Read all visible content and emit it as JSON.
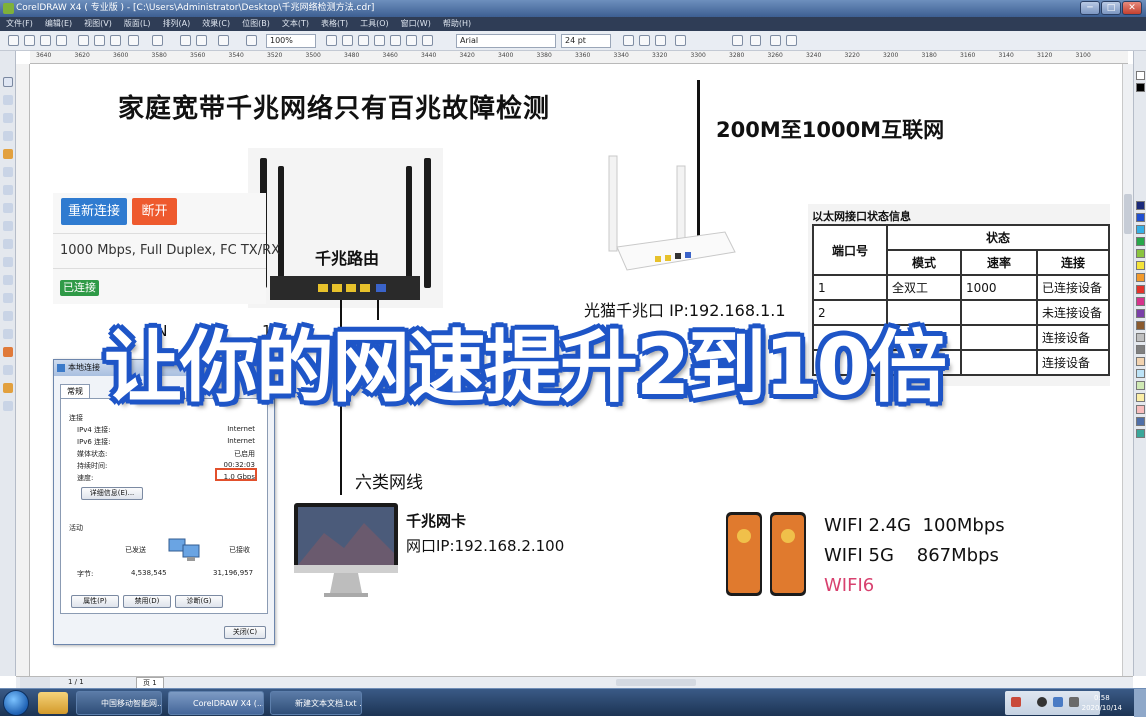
{
  "window": {
    "title": "CorelDRAW X4 ( 专业版 ) - [C:\\Users\\Administrator\\Desktop\\千兆网络检测方法.cdr]",
    "menu": [
      "文件(F)",
      "编辑(E)",
      "视图(V)",
      "版面(L)",
      "排列(A)",
      "效果(C)",
      "位图(B)",
      "文本(T)",
      "表格(T)",
      "工具(O)",
      "窗口(W)",
      "帮助(H)"
    ],
    "zoom": "100%",
    "font": "Arial",
    "font_size": "24 pt"
  },
  "ruler": [
    "3640",
    "3620",
    "3600",
    "3580",
    "3560",
    "3540",
    "3520",
    "3500",
    "3480",
    "3460",
    "3440",
    "3420",
    "3400",
    "3380",
    "3360",
    "3340",
    "3320",
    "3300",
    "3280",
    "3260",
    "3240",
    "3220",
    "3200",
    "3180",
    "3160",
    "3140",
    "3120",
    "3100"
  ],
  "statusbar": {
    "page_count": "1 / 1",
    "page_tab": "页 1"
  },
  "slide": {
    "title": "家庭宽带千兆网络只有百兆故障检测",
    "internet": "200M至1000M互联网",
    "route_panel": {
      "reconnect": "重新连接",
      "disconnect": "断开",
      "speed": "1000 Mbps, Full Duplex, FC TX/RX",
      "status": "已连接"
    },
    "router_label": "千兆路由",
    "modem_label": "光猫千兆口 IP:192.168.1.1",
    "wan_fragment": "AN",
    "lan_fragment": "16",
    "cable_label": "六类网线",
    "nic": {
      "title": "千兆网卡",
      "ip": "网口IP:192.168.2.100"
    },
    "wifi": {
      "line1": "WIFI 2.4G  100Mbps",
      "line2": "WIFI 5G    867Mbps",
      "line3": "WIFI6"
    },
    "eth_table": {
      "title": "以太网接口状态信息",
      "col_port": "端口号",
      "col_status": "状态",
      "col_mode": "模式",
      "col_rate": "速率",
      "col_link": "连接",
      "rows": [
        {
          "port": "1",
          "mode": "全双工",
          "rate": "1000",
          "link": "已连接设备"
        },
        {
          "port": "2",
          "mode": "",
          "rate": "",
          "link": "未连接设备"
        },
        {
          "port": "",
          "mode": "",
          "rate": "",
          "link": "连接设备"
        },
        {
          "port": "",
          "mode": "",
          "rate": "",
          "link": "连接设备"
        }
      ]
    },
    "banner": "让你的网速提升2到10倍"
  },
  "dialog": {
    "title": "本地连接",
    "tab": "常规",
    "section_connection": "连接",
    "rows": [
      {
        "label": "IPv4 连接:",
        "value": "Internet"
      },
      {
        "label": "IPv6 连接:",
        "value": "Internet"
      },
      {
        "label": "媒体状态:",
        "value": "已启用"
      },
      {
        "label": "持续时间:",
        "value": "00:32:03"
      },
      {
        "label": "速度:",
        "value": "1.0 Gbps"
      }
    ],
    "details_btn": "详细信息(E)...",
    "section_activity": "活动",
    "sent_label": "已发送",
    "recv_label": "已接收",
    "bytes_label": "字节:",
    "sent_bytes": "4,538,545",
    "recv_bytes": "31,196,957",
    "btn_properties": "属性(P)",
    "btn_disable": "禁用(D)",
    "btn_diagnose": "诊断(G)",
    "btn_close": "关闭(C)"
  },
  "taskbar": {
    "items": [
      "中国移动智能网...",
      "CorelDRAW X4 (...",
      "新建文本文档.txt ..."
    ],
    "time": "0:58",
    "date": "2020/10/14"
  }
}
